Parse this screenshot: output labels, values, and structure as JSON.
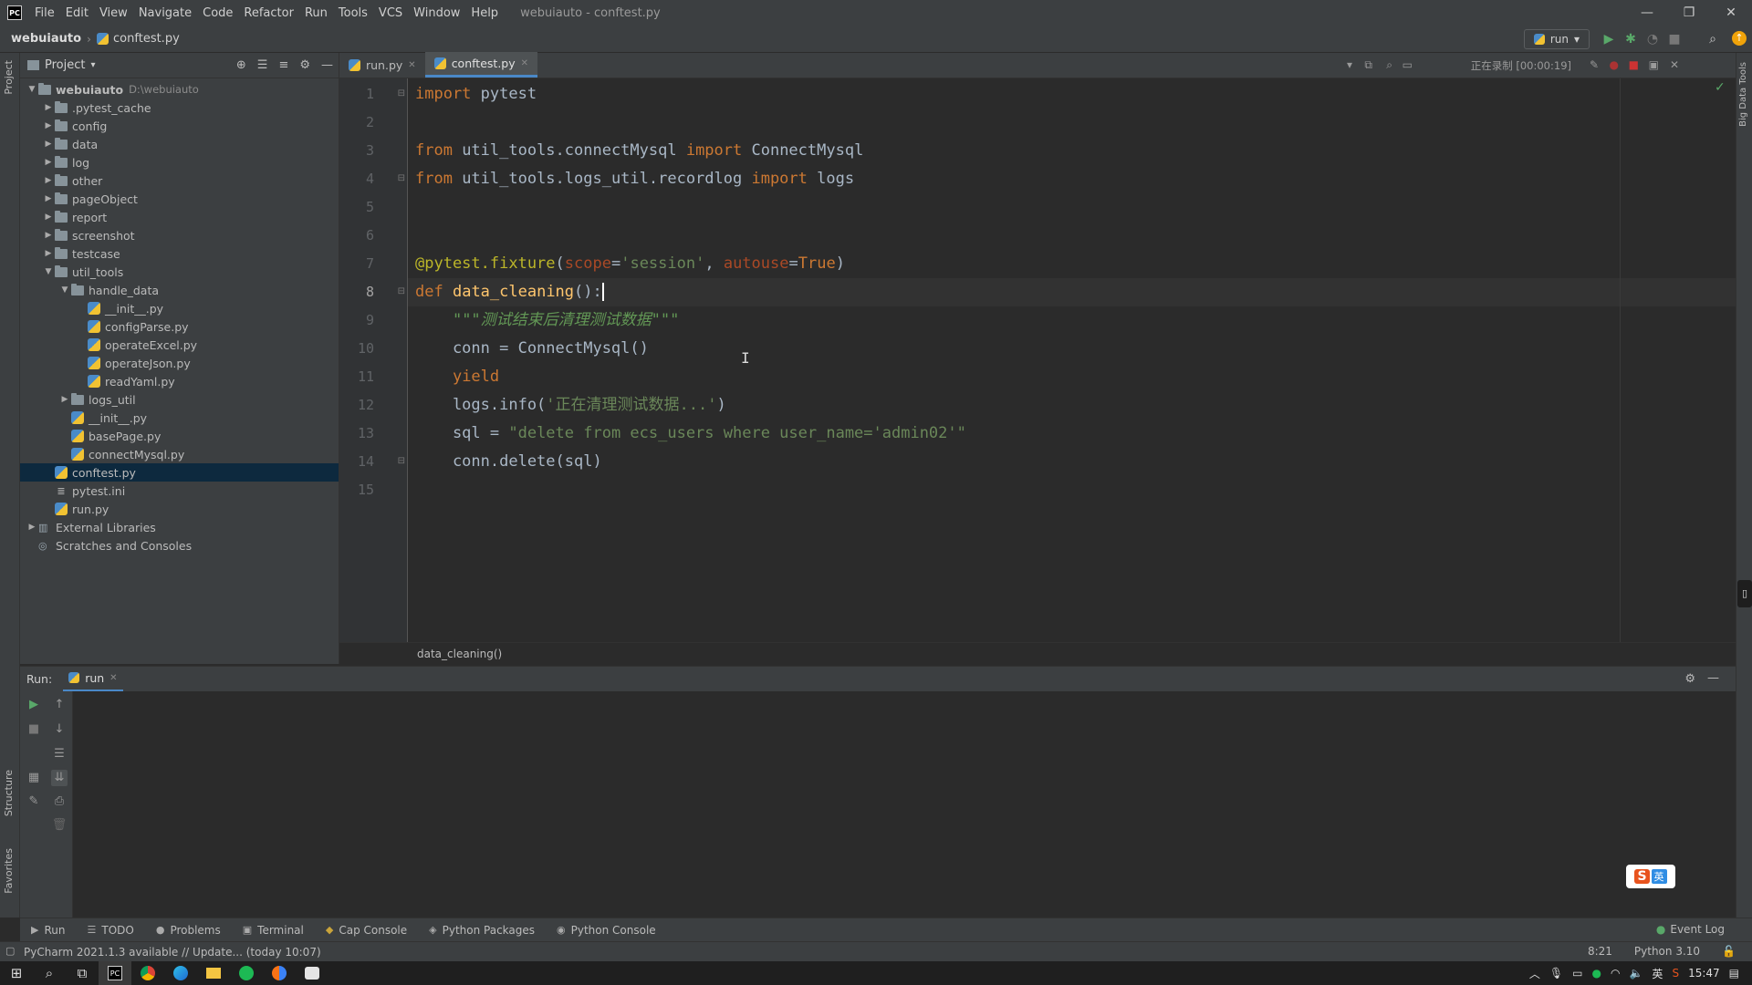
{
  "titlebar": {
    "app_logo": "PC",
    "menu": [
      "File",
      "Edit",
      "View",
      "Navigate",
      "Code",
      "Refactor",
      "Run",
      "Tools",
      "VCS",
      "Window",
      "Help"
    ],
    "window_title": "webuiauto - conftest.py",
    "controls": [
      "—",
      "❐",
      "✕"
    ]
  },
  "navbar": {
    "project": "webuiauto",
    "file": "conftest.py",
    "run_config": "run"
  },
  "left_stripe": {
    "project": "Project",
    "structure": "Structure",
    "favorites": "Favorites"
  },
  "right_stripe": {
    "bigdata": "Big Data Tools"
  },
  "project_panel": {
    "title": "Project",
    "tree": [
      {
        "label": "webuiauto",
        "path": "D:\\webuiauto",
        "type": "folder",
        "depth": 0,
        "expanded": true
      },
      {
        "label": ".pytest_cache",
        "type": "folder",
        "depth": 1
      },
      {
        "label": "config",
        "type": "folder",
        "depth": 1
      },
      {
        "label": "data",
        "type": "folder",
        "depth": 1
      },
      {
        "label": "log",
        "type": "folder",
        "depth": 1
      },
      {
        "label": "other",
        "type": "folder",
        "depth": 1
      },
      {
        "label": "pageObject",
        "type": "folder",
        "depth": 1
      },
      {
        "label": "report",
        "type": "folder",
        "depth": 1
      },
      {
        "label": "screenshot",
        "type": "folder",
        "depth": 1
      },
      {
        "label": "testcase",
        "type": "folder",
        "depth": 1
      },
      {
        "label": "util_tools",
        "type": "folder",
        "depth": 1,
        "expanded": true
      },
      {
        "label": "handle_data",
        "type": "folder",
        "depth": 2,
        "expanded": true
      },
      {
        "label": "__init__.py",
        "type": "py",
        "depth": 3
      },
      {
        "label": "configParse.py",
        "type": "py",
        "depth": 3
      },
      {
        "label": "operateExcel.py",
        "type": "py",
        "depth": 3
      },
      {
        "label": "operateJson.py",
        "type": "py",
        "depth": 3
      },
      {
        "label": "readYaml.py",
        "type": "py",
        "depth": 3
      },
      {
        "label": "logs_util",
        "type": "folder",
        "depth": 2
      },
      {
        "label": "__init__.py",
        "type": "py",
        "depth": 2
      },
      {
        "label": "basePage.py",
        "type": "py",
        "depth": 2
      },
      {
        "label": "connectMysql.py",
        "type": "py",
        "depth": 2
      },
      {
        "label": "conftest.py",
        "type": "py",
        "depth": 1,
        "selected": true
      },
      {
        "label": "pytest.ini",
        "type": "ini",
        "depth": 1
      },
      {
        "label": "run.py",
        "type": "py",
        "depth": 1
      },
      {
        "label": "External Libraries",
        "type": "lib",
        "depth": 0
      },
      {
        "label": "Scratches and Consoles",
        "type": "scratch",
        "depth": 0
      }
    ]
  },
  "editor": {
    "tabs": [
      {
        "label": "run.py",
        "active": false
      },
      {
        "label": "conftest.py",
        "active": true
      }
    ],
    "recording": "正在录制 [00:00:19]",
    "current_line": 8,
    "lines": [
      {
        "n": "1",
        "html": "<span class='kw'>import</span> pytest"
      },
      {
        "n": "2",
        "html": ""
      },
      {
        "n": "3",
        "html": "<span class='kw'>from</span> util_tools.connectMysql <span class='kw'>import</span> ConnectMysql"
      },
      {
        "n": "4",
        "html": "<span class='kw'>from</span> util_tools.logs_util.recordlog <span class='kw'>import</span> logs"
      },
      {
        "n": "5",
        "html": ""
      },
      {
        "n": "6",
        "html": ""
      },
      {
        "n": "7",
        "html": "<span class='dec'>@pytest.fixture</span>(<span class='prm'>scope</span>=<span class='str'>'session'</span>, <span class='prm'>autouse</span>=<span class='kw'>True</span>)"
      },
      {
        "n": "8",
        "html": "<span class='kw'>def</span> <span class='fn'>data_cleaning</span>():<span class='caret'></span>"
      },
      {
        "n": "9",
        "html": "    <span class='doc'>\"\"\"测试结束后清理测试数据\"\"\"</span>"
      },
      {
        "n": "10",
        "html": "    conn = ConnectMysql()"
      },
      {
        "n": "11",
        "html": "    <span class='kw'>yield</span>"
      },
      {
        "n": "12",
        "html": "    logs.info(<span class='str'>'正在清理测试数据...'</span>)"
      },
      {
        "n": "13",
        "html": "    sql = <span class='str'>\"delete from ecs_users where user_name='admin02'\"</span>"
      },
      {
        "n": "14",
        "html": "    conn.delete(sql)"
      },
      {
        "n": "15",
        "html": ""
      }
    ],
    "breadcrumb": "data_cleaning()"
  },
  "run_panel": {
    "label": "Run:",
    "tab": "run"
  },
  "tool_tabs": [
    "Run",
    "TODO",
    "Problems",
    "Terminal",
    "Cap Console",
    "Python Packages",
    "Python Console"
  ],
  "event_log": "Event Log",
  "status": {
    "message": "PyCharm 2021.1.3 available // Update... (today 10:07)",
    "position": "8:21",
    "interpreter": "Python 3.10"
  },
  "ime": {
    "s": "S",
    "lang": "英"
  },
  "taskbar": {
    "time": "15:47",
    "lang": "英"
  }
}
